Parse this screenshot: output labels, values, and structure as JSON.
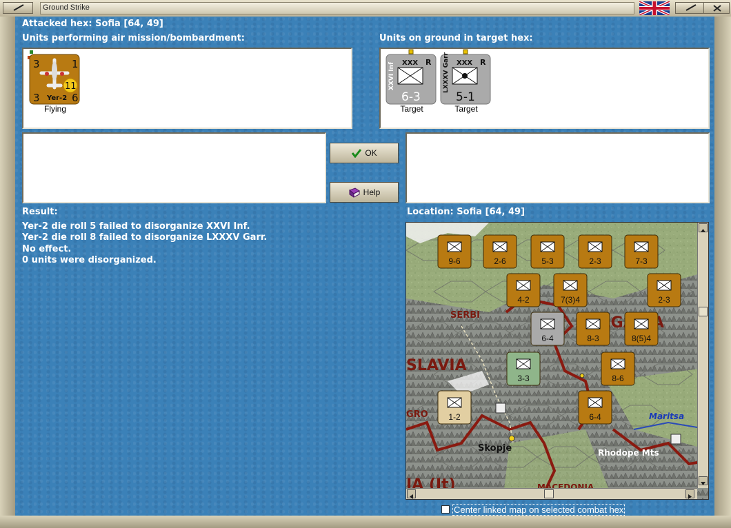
{
  "window": {
    "title": "Ground Strike"
  },
  "header": {
    "attacked_hex": "Attacked hex: Sofia  [64, 49]",
    "air_units_label": "Units performing air mission/bombardment:",
    "ground_units_label": "Units on ground in target hex:"
  },
  "air_units": [
    {
      "name": "Yer-2",
      "top_left": "3",
      "top_right": "1",
      "bottom_left": "3",
      "bottom_right": "6",
      "badge": "11",
      "status": "Flying",
      "color": "#b87a12"
    }
  ],
  "ground_units": [
    {
      "name": "XXVI Inf",
      "size": "XXX",
      "reserve": "R",
      "strength": "6-3",
      "status": "Target",
      "color": "#aaaaaa"
    },
    {
      "name": "LXXXV Garr",
      "size": "XXX",
      "reserve": "R",
      "strength": "5-1",
      "status": "Target",
      "color": "#aaaaaa"
    }
  ],
  "buttons": {
    "ok": "OK",
    "help": "Help"
  },
  "result": {
    "label": "Result:",
    "lines": [
      "Yer-2 die roll 5 failed to disorganize XXVI Inf.",
      "Yer-2 die roll 8 failed to disorganize LXXXV Garr.",
      "No effect.",
      "0 units were disorganized."
    ]
  },
  "location": {
    "label": "Location:  Sofia  [64, 49]"
  },
  "map": {
    "place_labels": [
      "SERBI",
      "SLAVIA",
      "Skopje",
      "Rhodope Mts",
      "Maritsa",
      "GRO",
      "IA (It)",
      "MACEDONIA",
      "BULGARIA"
    ],
    "counters": [
      {
        "strength": "9-6",
        "color": "#b87a12"
      },
      {
        "strength": "2-6",
        "color": "#b87a12"
      },
      {
        "strength": "5-3",
        "color": "#b87a12"
      },
      {
        "strength": "2-3",
        "color": "#b87a12"
      },
      {
        "strength": "7-3",
        "color": "#b87a12"
      },
      {
        "strength": "4-2",
        "color": "#b87a12"
      },
      {
        "strength": "7(3)4",
        "color": "#b87a12"
      },
      {
        "strength": "2-3",
        "color": "#b87a12"
      },
      {
        "strength": "6-4",
        "color": "#aaaaaa"
      },
      {
        "strength": "8-3",
        "color": "#b87a12"
      },
      {
        "strength": "8(5)4",
        "color": "#b87a12"
      },
      {
        "strength": "3-3",
        "color": "#8fb58a"
      },
      {
        "strength": "8-6",
        "color": "#b87a12"
      },
      {
        "strength": "6-4",
        "color": "#b87a12"
      },
      {
        "strength": "1-2",
        "color": "#e2cfa2"
      }
    ]
  },
  "footer": {
    "center_map_label": "Center linked map on selected combat hex"
  }
}
